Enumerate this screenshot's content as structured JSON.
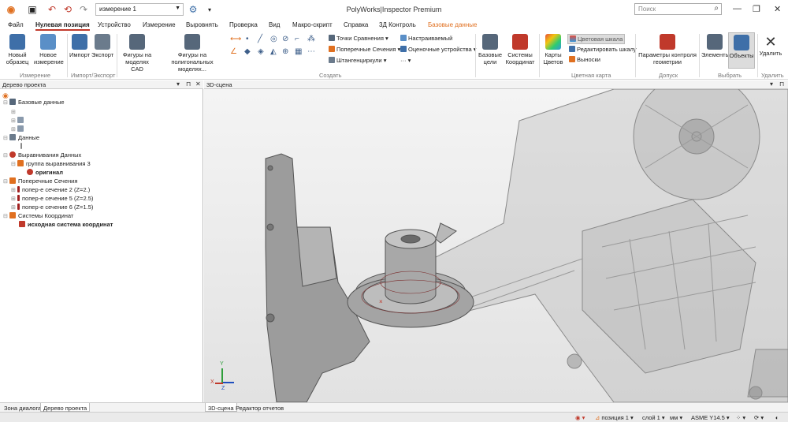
{
  "window": {
    "title": "PolyWorks|Inspector Premium",
    "search_placeholder": "Поиск",
    "measurement_select": "измерение 1"
  },
  "menu": {
    "tabs": [
      "Файл",
      "Нулевая позиция",
      "Устройство",
      "Измерение",
      "Выровнять",
      "Проверка",
      "Вид",
      "Макро-скрипт",
      "Справка",
      "3Д Контроль",
      "Базовые данные"
    ]
  },
  "ribbon": {
    "new_sample": "Новый образец",
    "new_measurement": "Новое измерение",
    "group_measurement": "Измерение",
    "import": "Импорт",
    "export": "Экспорт",
    "group_import_export": "Импорт/Экспорт",
    "cad_shapes": "Фигуры на моделях CAD",
    "poly_shapes": "Фигуры на полигональных моделях...",
    "compare_points": "Точки Сравнения",
    "cross_sections": "Поперечные Сечения",
    "calipers": "Штангенциркули",
    "custom": "Настраиваемый",
    "eval_devices": "Оценочные устройства",
    "group_create": "Создать",
    "base_targets": "Базовые цели",
    "coord_systems": "Системы Координат",
    "color_maps": "Карты Цветов",
    "color_scale": "Цветовая шкала",
    "edit_scale": "Редактировать шкалу",
    "callouts": "Выноски",
    "group_color_map": "Цветная карта",
    "geom_control": "Параметры контроля геометрии",
    "group_tolerance": "Допуск",
    "elements": "Элементы",
    "objects": "Объекты",
    "group_select": "Выбрать",
    "delete": "Удалить",
    "group_delete": "Удалить"
  },
  "tree": {
    "title": "Дерево проекта",
    "items": [
      {
        "label": "Базовые данные"
      },
      {
        "label": "Данные"
      },
      {
        "label": "Выравнивания Данных"
      },
      {
        "label": "группа выравнивания 3"
      },
      {
        "label": "оригинал"
      },
      {
        "label": "Поперечные Сечения"
      },
      {
        "label": "попер-е сечение 2 (Z=2.)"
      },
      {
        "label": "попер-е сечение 5 (Z=2.5)"
      },
      {
        "label": "попер-е сечение 6 (Z=1.5)"
      },
      {
        "label": "Системы Координат"
      },
      {
        "label": "исходная система координат"
      }
    ]
  },
  "scene": {
    "title": "3D-сцена",
    "axis_x": "X",
    "axis_y": "Y",
    "axis_z": "Z"
  },
  "bottom_tabs": {
    "left": [
      "Зона диалога",
      "Дерево проекта"
    ],
    "right": [
      "3D-сцена",
      "Редактор отчетов"
    ]
  },
  "status": {
    "position": "позиция 1",
    "layer": "слой 1",
    "units": "мм",
    "standard": "ASME Y14.5"
  },
  "colors": {
    "accent": "#c0392b",
    "orange_tab": "#e07020",
    "panel_bg": "#f3f3f3"
  }
}
